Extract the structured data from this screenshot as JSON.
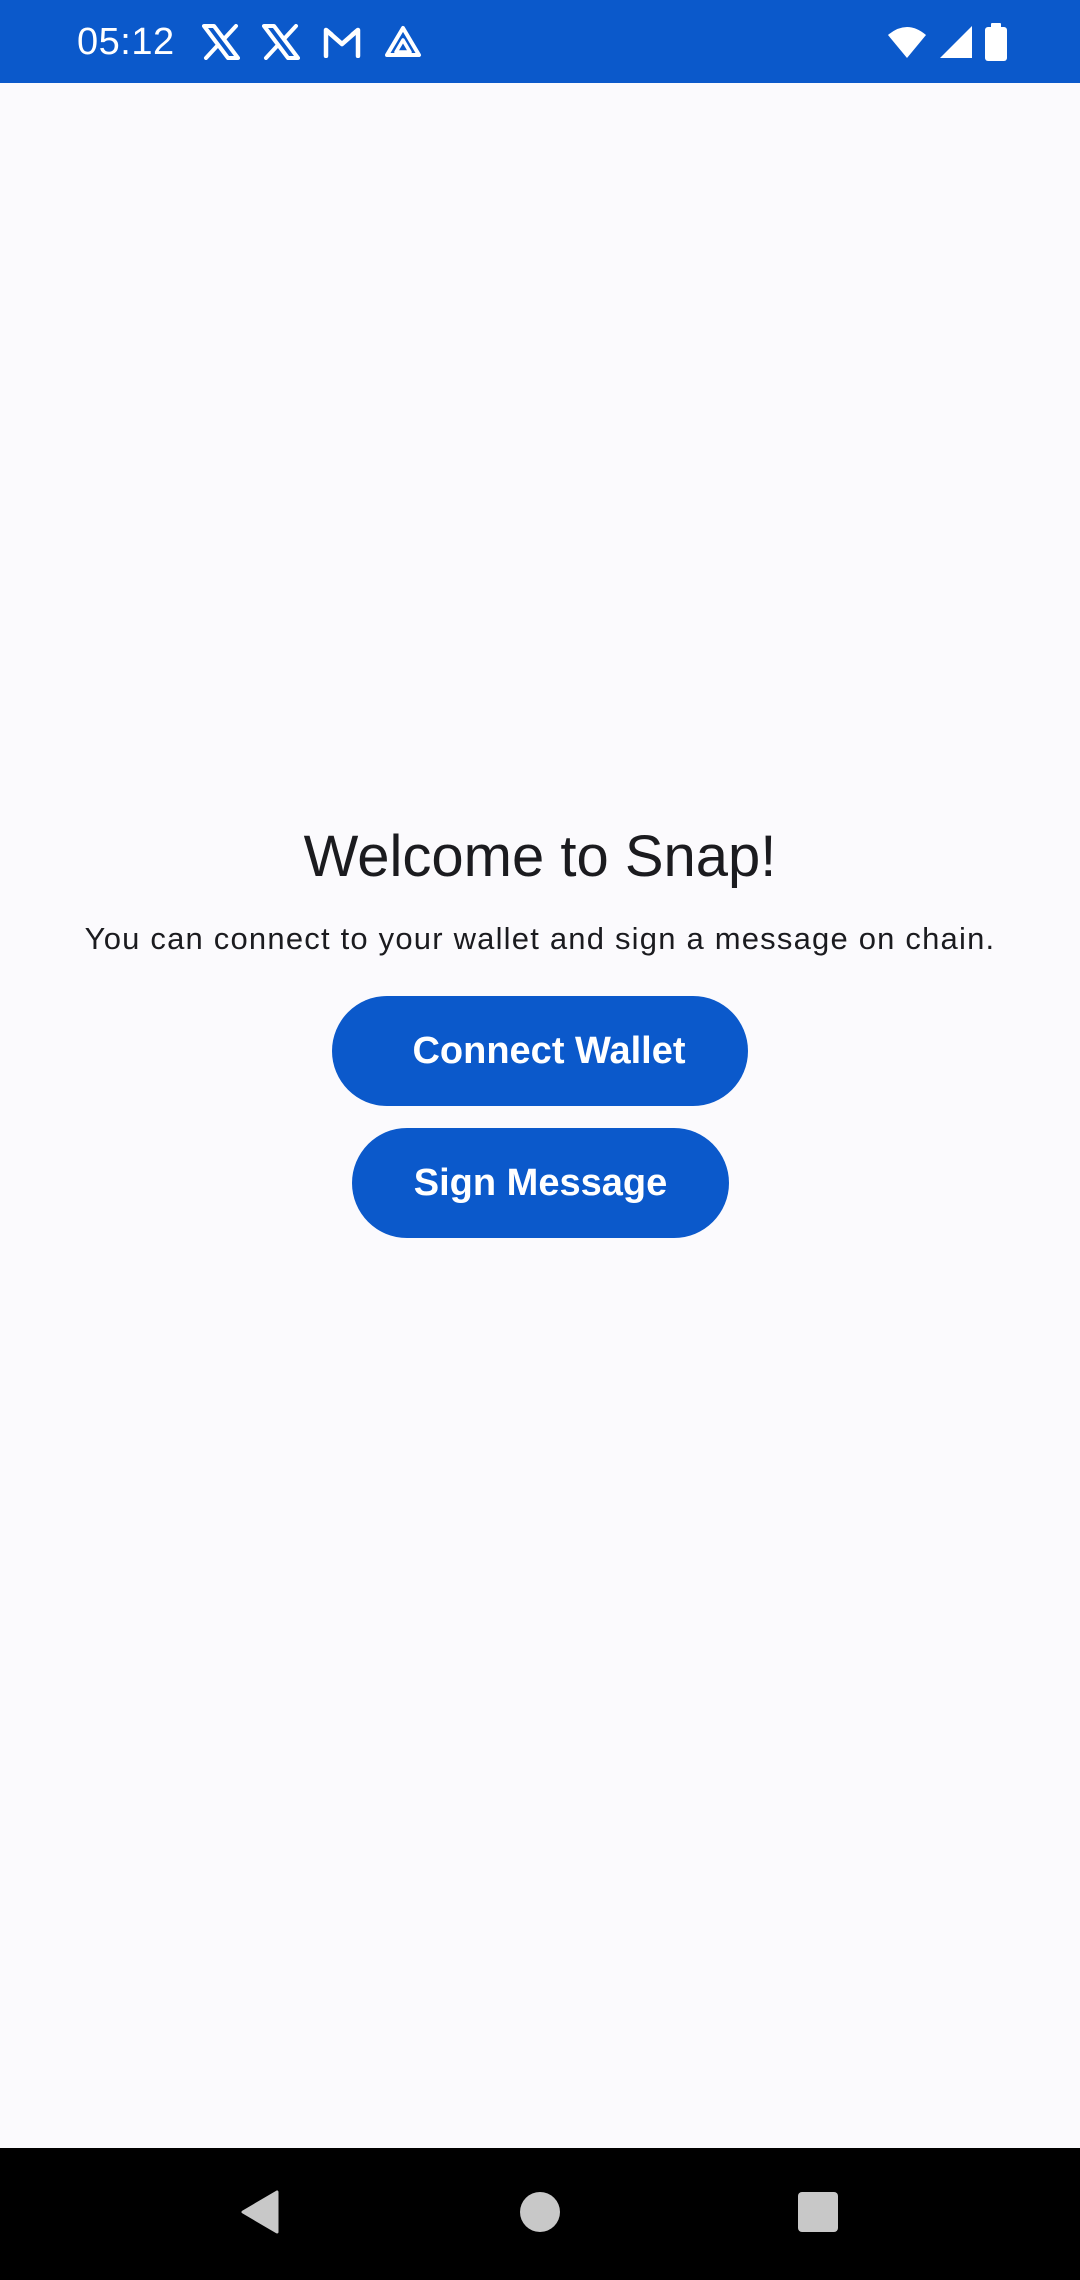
{
  "status_bar": {
    "time": "05:12",
    "background": "#0b59cb",
    "notification_icons": [
      "x-icon",
      "x-icon",
      "gmail-icon",
      "drive-icon"
    ],
    "system_icons": [
      "wifi-icon",
      "signal-icon",
      "battery-icon"
    ]
  },
  "main": {
    "title": "Welcome to Snap!",
    "subtitle": "You can connect to your wallet and sign a message on chain.",
    "connect_wallet_label": "Connect Wallet",
    "sign_message_label": "Sign Message",
    "accent_color": "#0b59cb",
    "background": "#fbfafd"
  },
  "nav_bar": {
    "buttons": [
      "back-icon",
      "home-icon",
      "recents-icon"
    ]
  }
}
